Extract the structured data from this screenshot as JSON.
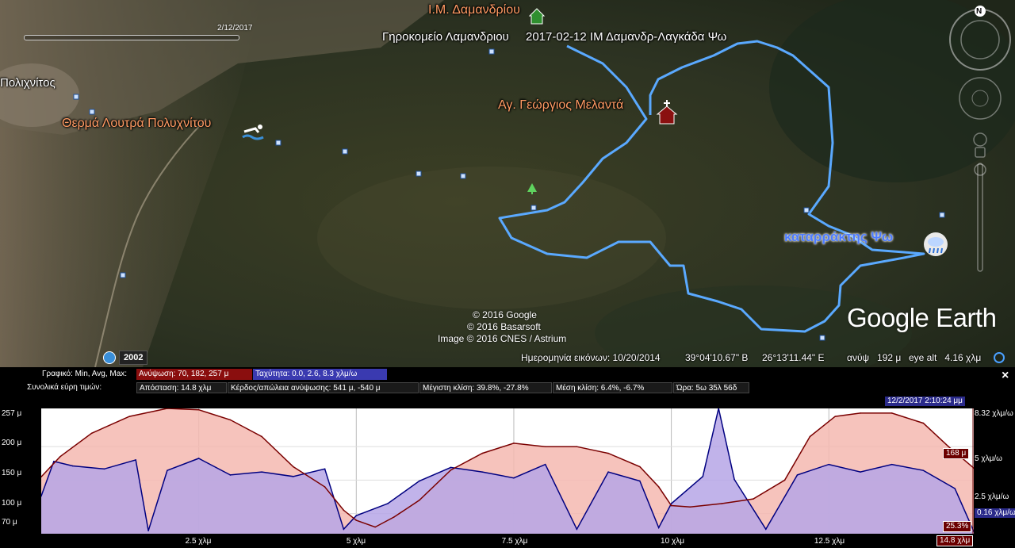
{
  "map": {
    "time_slider_date": "2/12/2017",
    "places": {
      "monastery": "Ι.Μ. Δαμανδρίου",
      "home": "Γηροκομείο Λαμανδριου",
      "track": "2017-02-12 ΙΜ Δαμανδρ-Λαγκάδα Ψω",
      "village": "Πολιχνίτος",
      "baths": "Θερμά Λουτρά Πολυχνίτου",
      "church": "Αγ. Γεώργιος Μελαντά",
      "waterfall": "καταρράκτης Ψω"
    },
    "copyright": [
      "© 2016 Google",
      "© 2016 Basarsoft",
      "Image © 2016 CNES / Astrium"
    ],
    "logo": "Google Earth",
    "compass_letter": "N",
    "history_year": "2002"
  },
  "statusbar": {
    "imagery_date": "Ημερομηνία εικόνων: 10/20/2014",
    "lat": "39°04'10.67\" Β",
    "lon": "26°13'11.44\" Ε",
    "elev": "ανύψ   192 μ",
    "eye_alt": "eye alt   4.16 χλμ"
  },
  "profile": {
    "graph_label": "Γραφικό: Min, Avg, Max:",
    "elev_stat": "Ανύψωση: 70, 182, 257 μ",
    "speed_stat": "Ταχύτητα: 0.0, 2.6, 8.3 χλμ/ω",
    "ranges_label": "Συνολικά εύρη τιμών:",
    "distance_stat": "Απόσταση: 14.8 χλμ",
    "gain_stat": "Κέρδος/απώλεια ανύψωσης: 541 μ, -540 μ",
    "max_slope_stat": "Μέγιστη κλίση: 39.8%, -27.8%",
    "avg_slope_stat": "Μέση κλίση: 6.4%, -6.7%",
    "time_stat": "Ώρα: 5ω 35λ 56δ",
    "close": "×",
    "cursor_time": "12/2/2017 2:10:24 μμ",
    "cursor_elev": "168 μ",
    "cursor_slope": "25.3%",
    "cursor_dist": "14.8 χλμ",
    "cursor_speed": "0.16 χλμ/ω",
    "y_left": [
      "257 μ",
      "200 μ",
      "150 μ",
      "100 μ",
      "70 μ"
    ],
    "y_right": [
      "8.32 χλμ/ω",
      "5 χλμ/ω",
      "2.5 χλμ/ω"
    ],
    "x_labels": [
      "2.5 χλμ",
      "5 χλμ",
      "7.5 χλμ",
      "10 χλμ",
      "12.5 χλμ"
    ],
    "colors": {
      "elev_line": "#7a0000",
      "elev_fill": "#f5b8b0",
      "speed_line": "#000080",
      "speed_fill": "#b6a6e6"
    }
  },
  "chart_data": {
    "type": "area",
    "xlabel": "",
    "ylabel": "",
    "xlim": [
      0,
      14.8
    ],
    "ylim": [
      70,
      257
    ],
    "y2lim": [
      0,
      8.32
    ],
    "series": [
      {
        "name": "Ανύψωση",
        "x": [
          0,
          0.3,
          0.8,
          1.4,
          2.0,
          2.5,
          3.0,
          3.5,
          4.0,
          4.5,
          4.8,
          5.0,
          5.3,
          5.6,
          6.0,
          6.5,
          7.0,
          7.5,
          8.0,
          8.5,
          9.0,
          9.5,
          9.8,
          10.0,
          10.3,
          10.8,
          11.3,
          11.8,
          12.2,
          12.6,
          13.0,
          13.5,
          14.0,
          14.4,
          14.8
        ],
        "values": [
          155,
          185,
          220,
          245,
          257,
          255,
          240,
          215,
          170,
          140,
          105,
          90,
          80,
          95,
          120,
          165,
          190,
          205,
          200,
          200,
          190,
          170,
          140,
          112,
          110,
          115,
          122,
          150,
          215,
          245,
          250,
          250,
          235,
          200,
          168
        ]
      },
      {
        "name": "Ταχύτητα",
        "x": [
          0,
          0.2,
          0.5,
          1.0,
          1.5,
          1.7,
          2.0,
          2.5,
          3.0,
          3.5,
          4.0,
          4.5,
          4.8,
          5.0,
          5.5,
          6.0,
          6.5,
          7.0,
          7.5,
          8.0,
          8.5,
          9.0,
          9.5,
          9.8,
          10.0,
          10.5,
          10.75,
          11.0,
          11.5,
          12.0,
          12.5,
          13.0,
          13.5,
          14.0,
          14.5,
          14.8
        ],
        "values": [
          2.5,
          4.8,
          4.5,
          4.3,
          4.9,
          0.2,
          4.2,
          5.0,
          3.9,
          4.1,
          3.8,
          4.3,
          0.3,
          1.2,
          2.0,
          3.5,
          4.4,
          4.1,
          3.7,
          4.6,
          0.3,
          4.1,
          3.5,
          0.4,
          2.0,
          3.8,
          8.32,
          3.6,
          0.3,
          3.9,
          4.6,
          4.1,
          4.6,
          4.2,
          3.0,
          0.16
        ]
      }
    ]
  }
}
